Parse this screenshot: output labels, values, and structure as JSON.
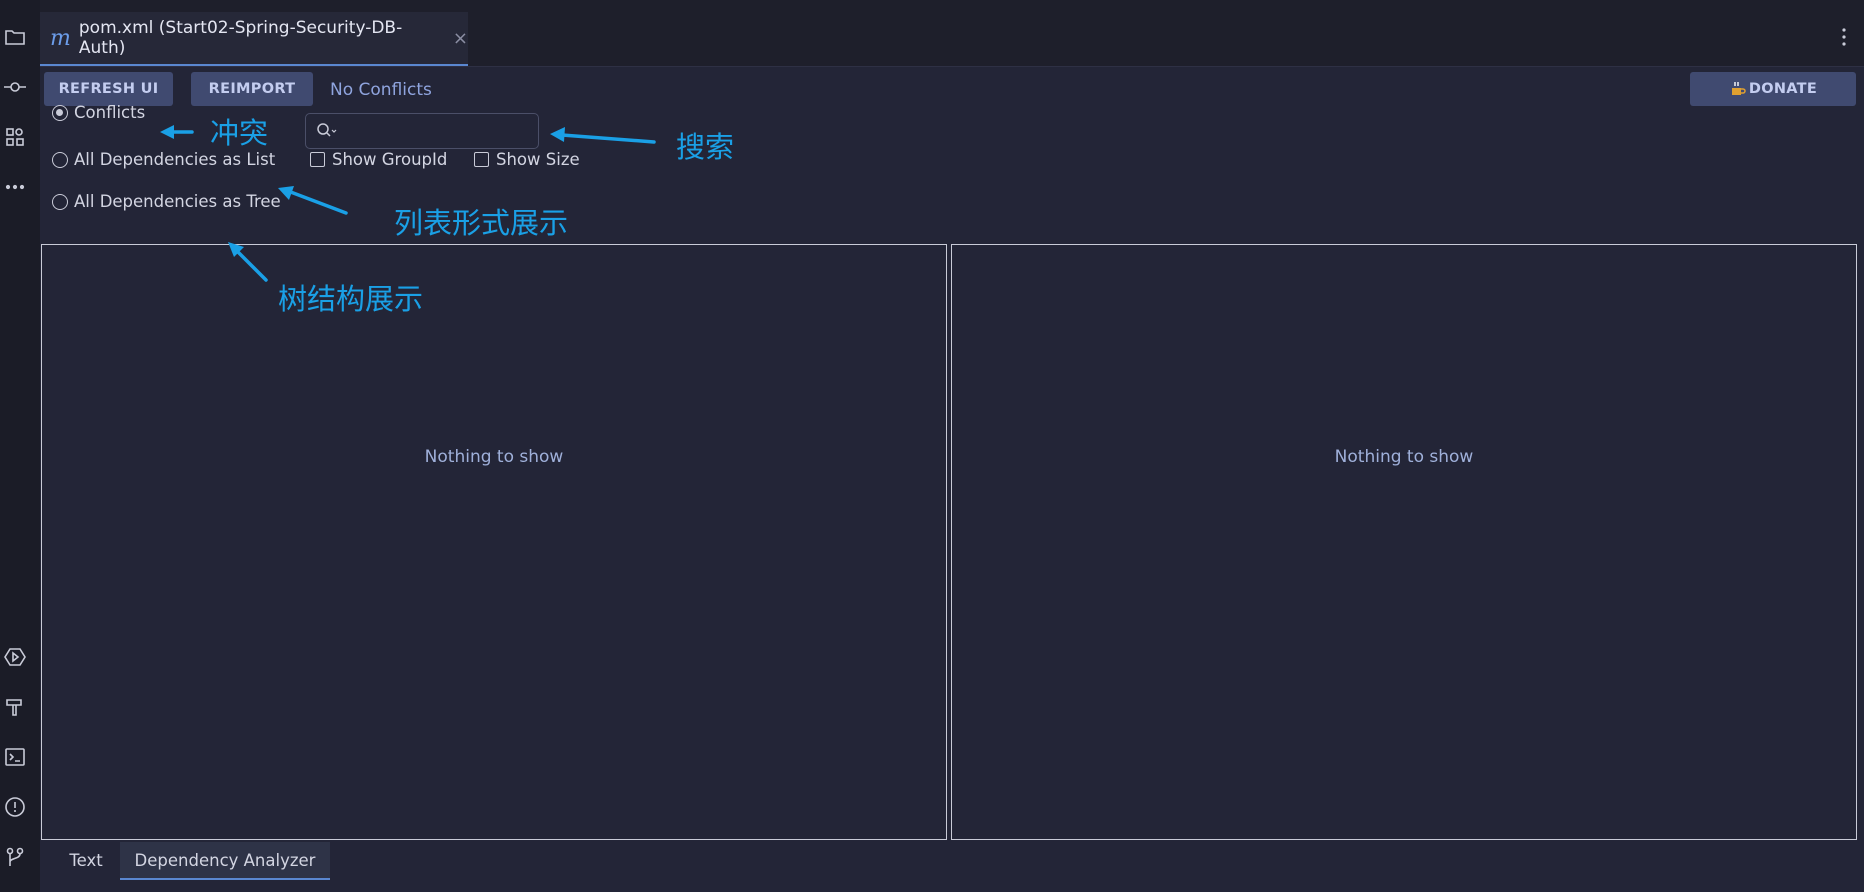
{
  "editor_tab": {
    "label": "pom.xml (Start02-Spring-Security-DB-Auth)",
    "icon": "maven-icon",
    "close": "×"
  },
  "toolbar": {
    "refresh_label": "REFRESH UI",
    "reimport_label": "REIMPORT",
    "status": "No Conflicts",
    "donate_label": "DONATE",
    "donate_icon": "coffee-icon"
  },
  "options": {
    "conflicts": "Conflicts",
    "list": "All Dependencies as List",
    "show_groupid": "Show GroupId",
    "show_size": "Show Size",
    "tree": "All Dependencies as Tree",
    "selected": "conflicts"
  },
  "search": {
    "value": "",
    "placeholder": ""
  },
  "panes": {
    "left_empty": "Nothing to show",
    "right_empty": "Nothing to show"
  },
  "bottom_tabs": [
    {
      "label": "Text"
    },
    {
      "label": "Dependency Analyzer",
      "active": true
    }
  ],
  "annotations": {
    "conflicts": "冲突",
    "search": "搜索",
    "list": "列表形式展示",
    "tree": "树结构展示"
  },
  "colors": {
    "accent": "#5a87d0",
    "annotation": "#1aa0e6",
    "button": "#404a70"
  }
}
